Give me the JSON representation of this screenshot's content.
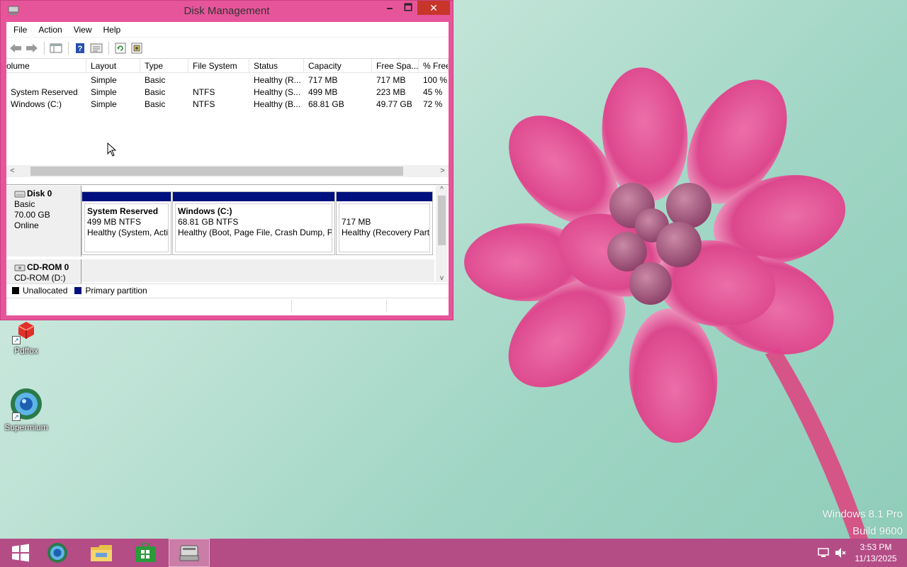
{
  "os": {
    "watermark_line1": "Windows 8.1 Pro",
    "watermark_line2": "Build 9600"
  },
  "desktop": {
    "icons": [
      {
        "label": "Pdffox",
        "icon": "pdffox-app-icon"
      },
      {
        "label": "Supermium",
        "icon": "supermium-browser-icon"
      }
    ]
  },
  "window": {
    "title": "Disk Management",
    "minimize": "🗕",
    "maximize": "🗖",
    "close": "✕",
    "menu": [
      "File",
      "Action",
      "View",
      "Help"
    ],
    "toolbar_icons": [
      "back-arrow-icon",
      "forward-arrow-icon",
      "console-tree-icon",
      "help-icon",
      "properties-icon",
      "refresh-icon",
      "rescan-disks-icon"
    ]
  },
  "volume_list": {
    "columns": [
      "olume",
      "Layout",
      "Type",
      "File System",
      "Status",
      "Capacity",
      "Free Spa...",
      "% Free"
    ],
    "rows": [
      [
        "",
        "Simple",
        "Basic",
        "",
        "Healthy (R...",
        "717 MB",
        "717 MB",
        "100 %"
      ],
      [
        "System Reserved",
        "Simple",
        "Basic",
        "NTFS",
        "Healthy (S...",
        "499 MB",
        "223 MB",
        "45 %"
      ],
      [
        "Windows (C:)",
        "Simple",
        "Basic",
        "NTFS",
        "Healthy (B...",
        "68.81 GB",
        "49.77 GB",
        "72 %"
      ]
    ],
    "scroll_left": "<",
    "scroll_right": ">"
  },
  "disks": {
    "disk0": {
      "name": "Disk 0",
      "type": "Basic",
      "size": "70.00 GB",
      "state": "Online",
      "partitions": [
        {
          "name": "System Reserved",
          "size": "499 MB NTFS",
          "status": "Healthy (System, Acti"
        },
        {
          "name": "Windows  (C:)",
          "size": "68.81 GB NTFS",
          "status": "Healthy (Boot, Page File, Crash Dump, Pr"
        },
        {
          "name": "",
          "size": "717 MB",
          "status": "Healthy (Recovery Parti"
        }
      ]
    },
    "cdrom0": {
      "name": "CD-ROM 0",
      "sub": "CD-ROM (D:)"
    },
    "scroll_up": "^",
    "scroll_down": "v"
  },
  "legend": {
    "unallocated": "Unallocated",
    "primary": "Primary partition",
    "unallocated_color": "#000000",
    "primary_color": "#00107e"
  },
  "taskbar": {
    "apps": [
      "start-button",
      "supermium-browser-icon",
      "file-explorer-icon",
      "store-icon",
      "disk-management-icon"
    ],
    "time": "3:53 PM",
    "date": "11/13/2025",
    "accent": "#b44c86"
  }
}
